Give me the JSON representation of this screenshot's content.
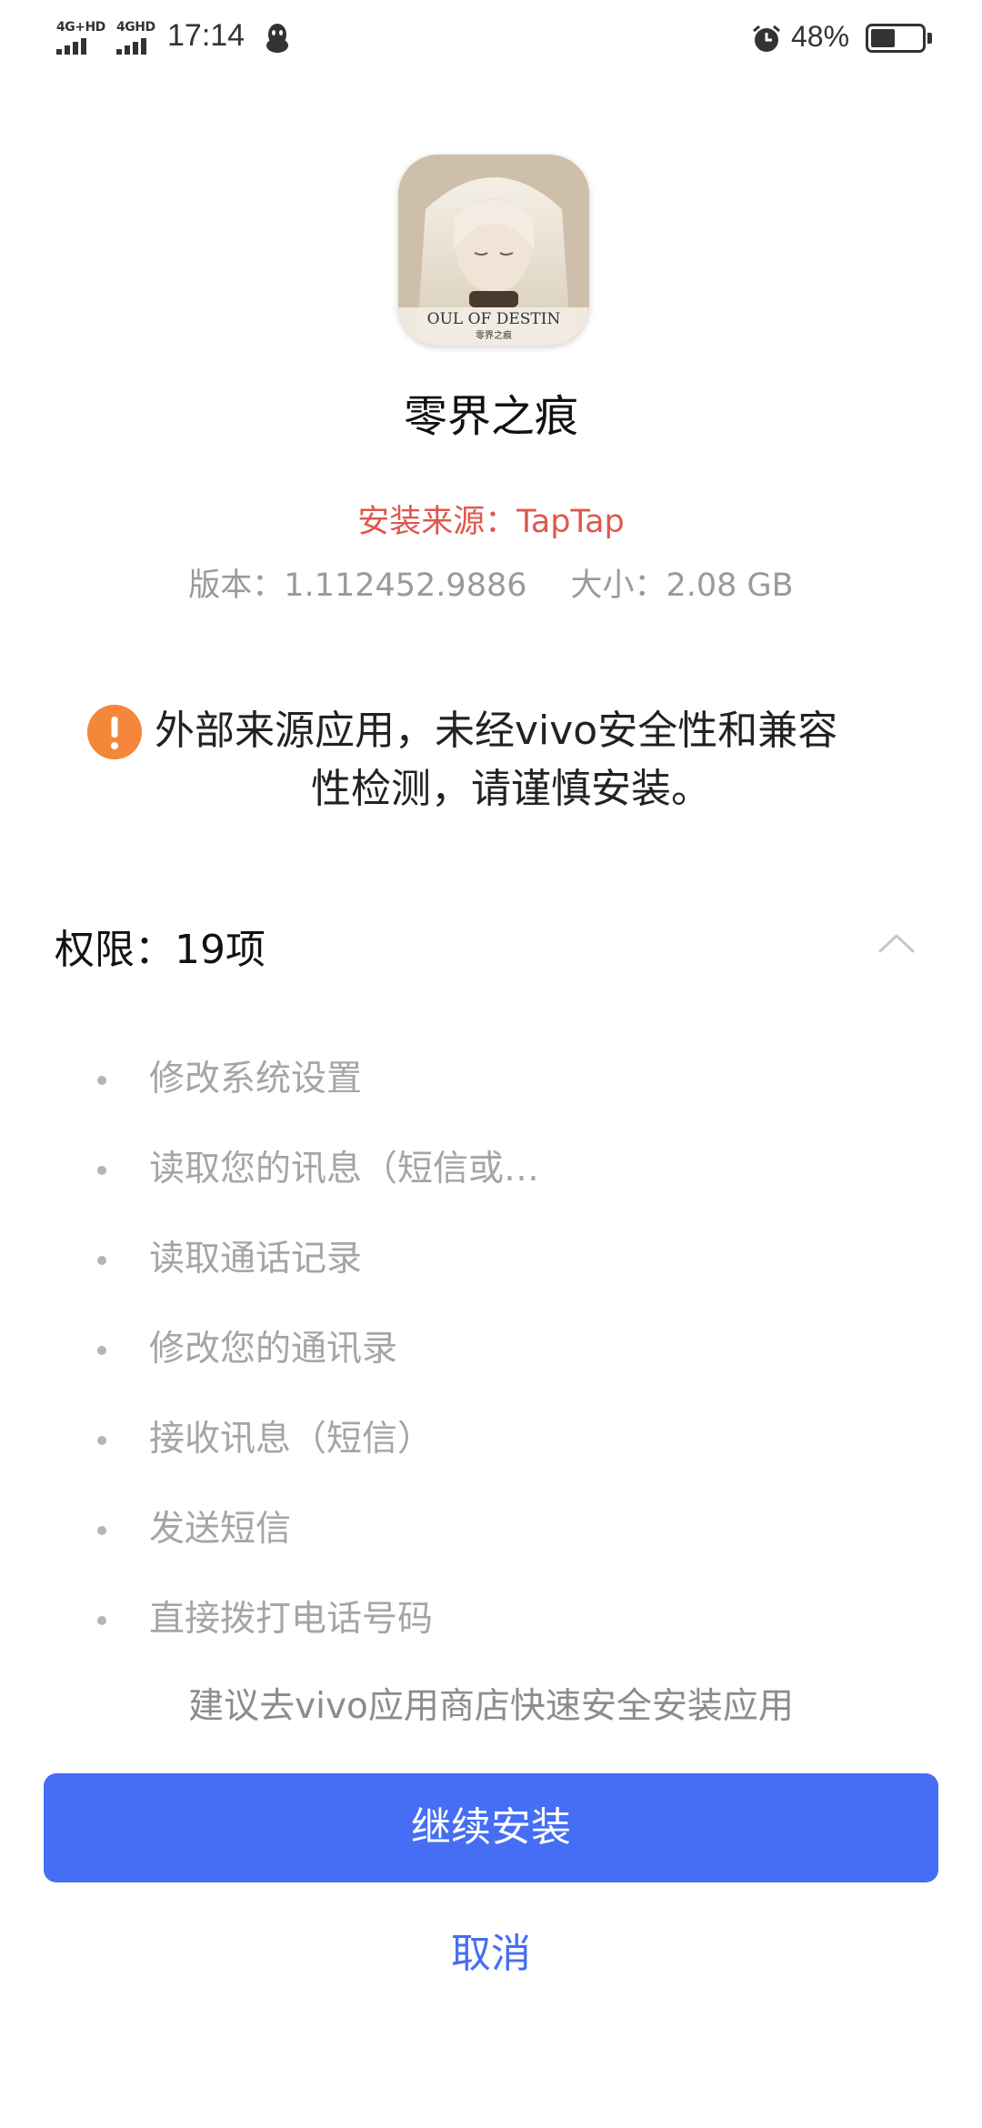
{
  "status_bar": {
    "sim1_label": "4G+HD",
    "sim2_label": "4GHD",
    "time": "17:14",
    "battery_percent_text": "48%",
    "battery_level": 0.48
  },
  "app": {
    "icon_text": "OUL OF DESTIN",
    "icon_subtext": "零界之痕",
    "name": "零界之痕",
    "source": "安装来源：TapTap",
    "version": "版本：1.112452.9886",
    "size": "大小：2.08 GB"
  },
  "warning": {
    "line1": "外部来源应用，未经vivo安全性和兼容",
    "line2": "性检测，请谨慎安装。"
  },
  "permissions": {
    "header": "权限：19项",
    "items": [
      "修改系统设置",
      "读取您的讯息（短信或…",
      "读取通话记录",
      "修改您的通讯录",
      "接收讯息（短信）",
      "发送短信",
      "直接拨打电话号码"
    ]
  },
  "suggestion": "建议去vivo应用商店快速安全安装应用",
  "buttons": {
    "continue": "继续安装",
    "cancel": "取消"
  },
  "colors": {
    "primary": "#456ef5",
    "source_red": "#e0574d",
    "warning_orange": "#f5873b"
  }
}
